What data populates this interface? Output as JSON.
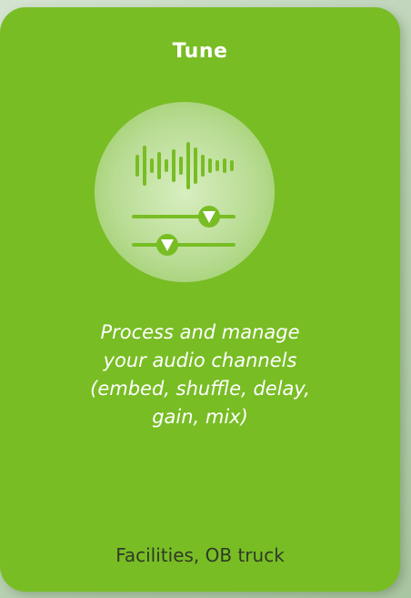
{
  "card": {
    "title": "Tune",
    "description": "Process and manage\n your audio channels\n(embed, shuffle, delay,\ngain, mix)",
    "footer": "Facilities, OB truck"
  },
  "icon": {
    "name": "audio-tune-icon",
    "accent": "#78bd24",
    "light": "#ffffff"
  }
}
